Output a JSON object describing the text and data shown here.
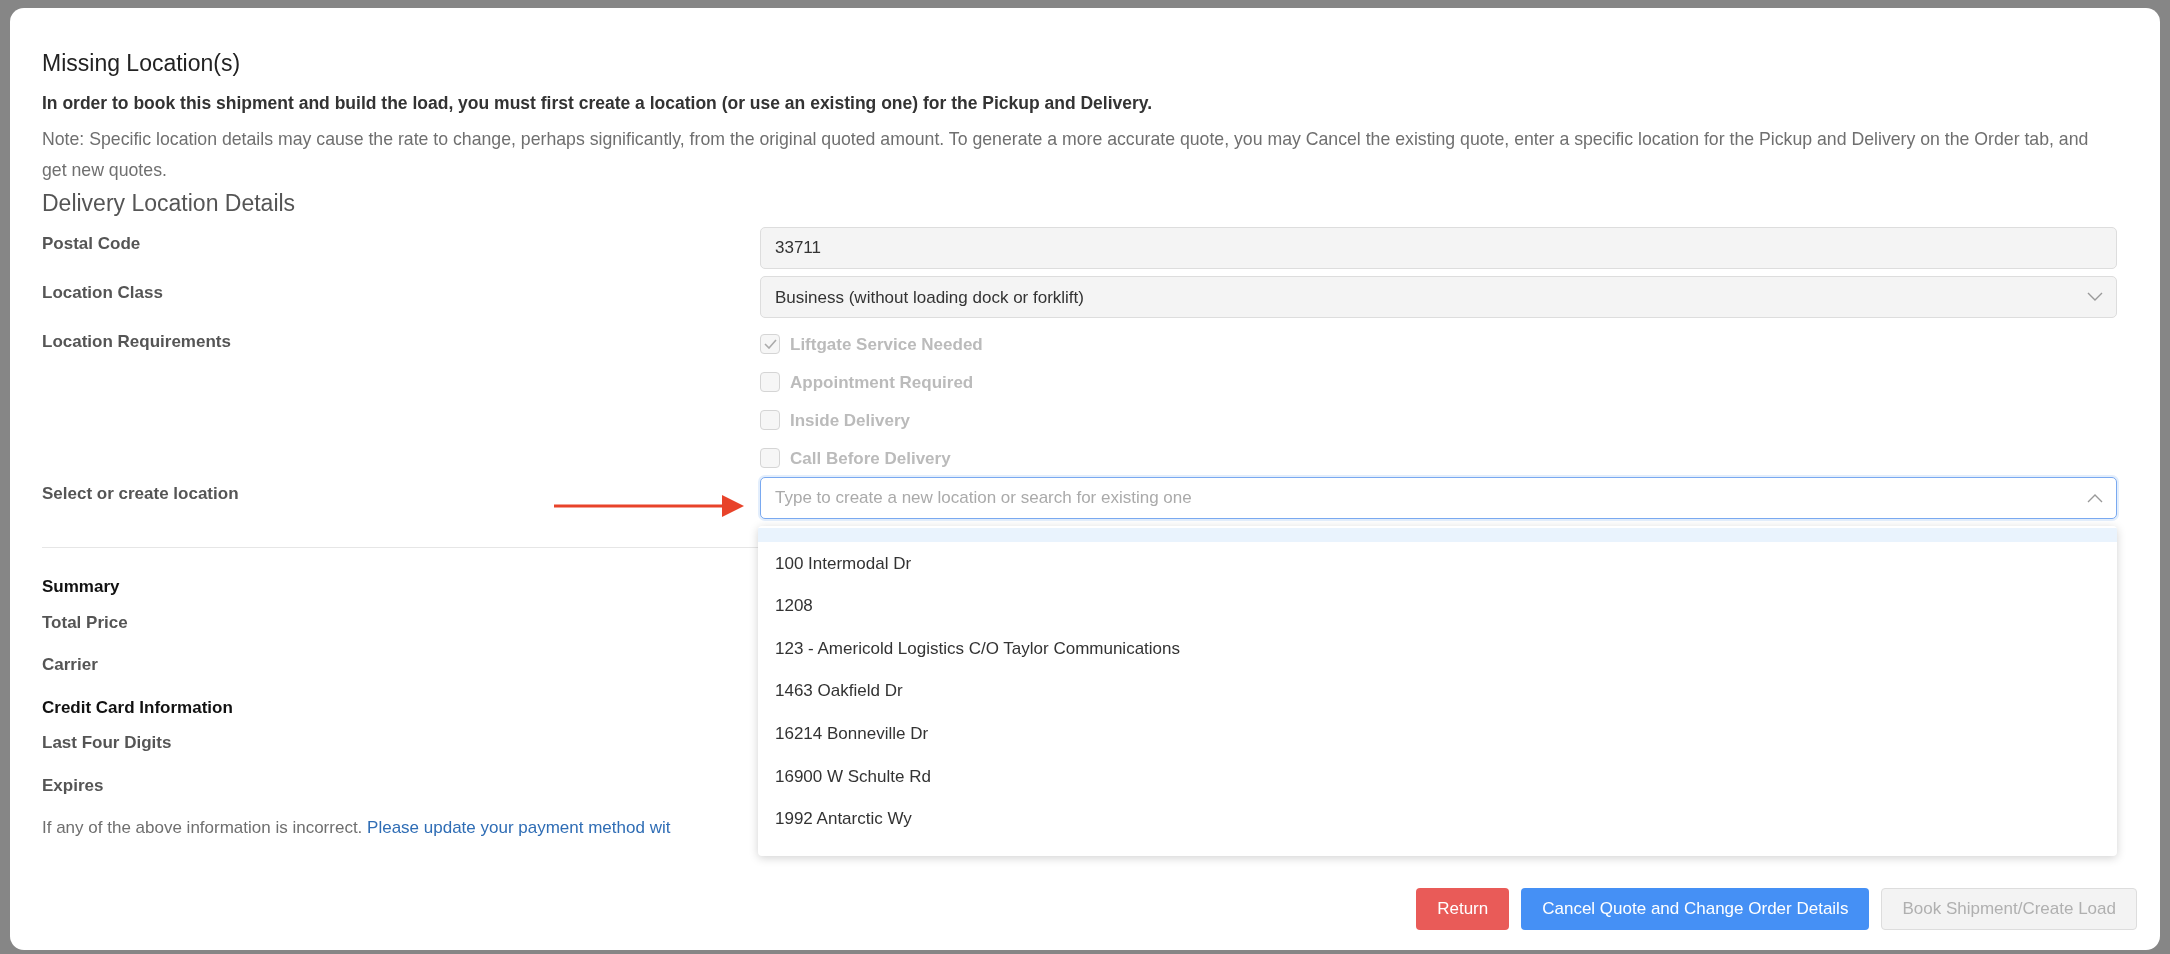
{
  "dialog": {
    "title": "Missing Location(s)",
    "intro": "In order to book this shipment and build the load, you must first create a location (or use an existing one) for the Pickup and Delivery.",
    "note": "Note: Specific location details may cause the rate to change, perhaps significantly, from the original quoted amount. To generate a more accurate quote, you may Cancel the existing quote, enter a specific location for the Pickup and Delivery on the Order tab, and get new quotes."
  },
  "section_title": "Delivery Location Details",
  "fields": [
    {
      "kind": "input",
      "label": "Postal Code",
      "value": "33711"
    },
    {
      "kind": "select",
      "label": "Location Class",
      "value": "Business (without loading dock or forklift)"
    },
    {
      "kind": "checkboxes",
      "label": "Location Requirements",
      "disabled": true,
      "options": [
        {
          "label": "Liftgate Service Needed",
          "checked": true
        },
        {
          "label": "Appointment Required",
          "checked": false
        },
        {
          "label": "Inside Delivery",
          "checked": false
        },
        {
          "label": "Call Before Delivery",
          "checked": false
        }
      ]
    },
    {
      "kind": "combobox",
      "label": "Select or create location",
      "placeholder": "Type to create a new location or search for existing one",
      "expanded": true,
      "options": [
        {
          "label": "100 Intermodal Dr"
        },
        {
          "label": "1208"
        },
        {
          "label": "123 - Americold Logistics C/O Taylor Communications"
        },
        {
          "label": "1463 Oakfield Dr"
        },
        {
          "label": "16214 Bonneville Dr"
        },
        {
          "label": "16900 W Schulte Rd"
        },
        {
          "label": "1992 Antarctic Wy"
        }
      ]
    }
  ],
  "summary": {
    "title": "Summary",
    "rows": [
      "Total Price",
      "Carrier"
    ]
  },
  "credit_card": {
    "title": "Credit Card Information",
    "rows": [
      "Last Four Digits",
      "Expires"
    ]
  },
  "notice": {
    "text": "If any of the above information is incorrect.",
    "link": "Please update your payment method wit"
  },
  "buttons": [
    {
      "label": "Return",
      "kind": "danger"
    },
    {
      "label": "Cancel Quote and Change Order Details",
      "kind": "primary"
    },
    {
      "label": "Book Shipment/Create Load",
      "kind": "disabled"
    }
  ]
}
